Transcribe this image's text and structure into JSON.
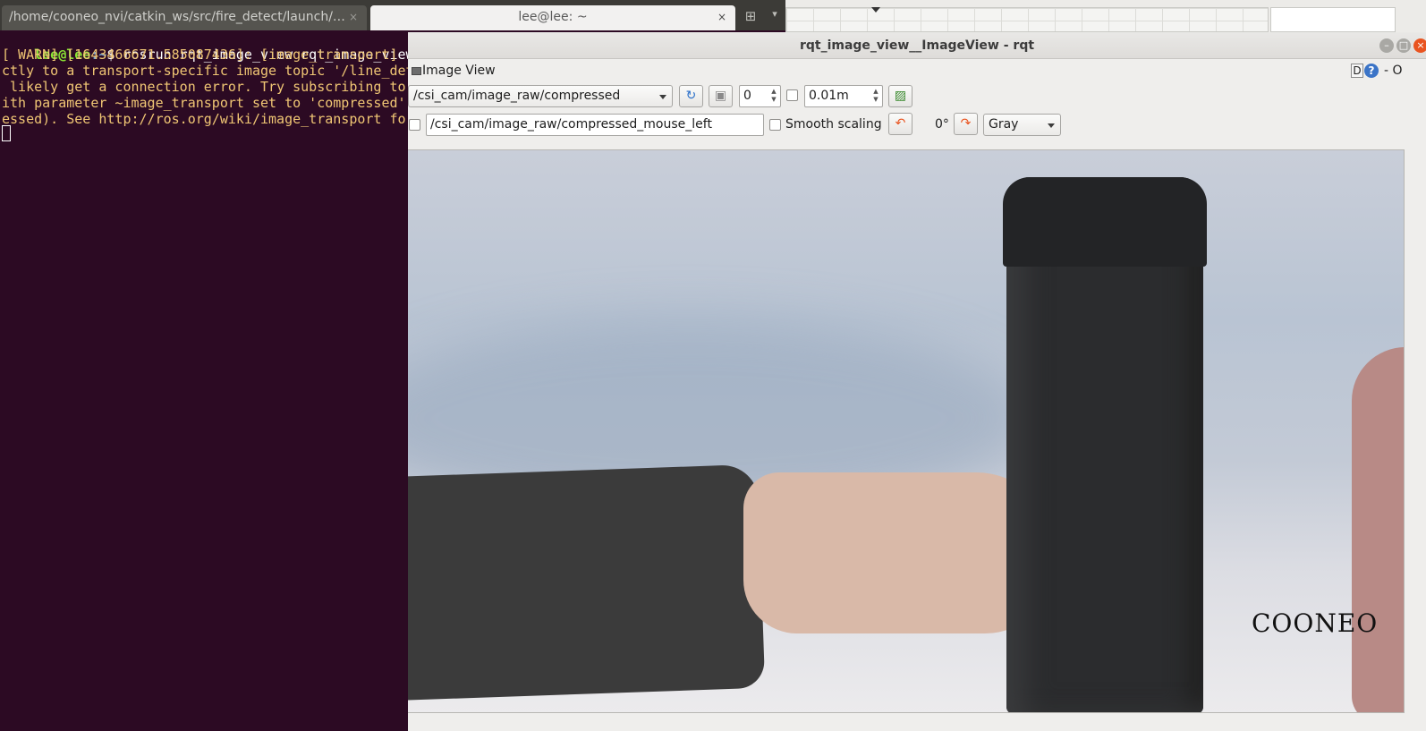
{
  "terminal": {
    "tabs": [
      {
        "label": "/home/cooneo_nvi/catkin_ws/src/fire_detect/launch/…",
        "close": "×"
      },
      {
        "label": "lee@lee: ~",
        "close": "×"
      }
    ],
    "new_tab_icon": "⊞",
    "menu_icon": "▾",
    "prompt_user": "lee@lee",
    "prompt_path": ":~",
    "prompt_symbol": "$ ",
    "command": "rosrun rqt_image_view rqt_image_view",
    "warn_lines": [
      "[ WARN] [1643466671.585087436]: [image_transport] ",
      "ctly to a transport-specific image topic '/line_det",
      " likely get a connection error. Try subscribing to",
      "ith parameter ~image_transport set to 'compressed'",
      "essed). See http://ros.org/wiki/image_transport for"
    ],
    "text_color": "#f0c674",
    "background": "#2c0a23"
  },
  "rqt": {
    "window_title": "rqt_image_view__ImageView - rqt",
    "plugin_title": "Image View",
    "d_label": "D",
    "help_label": "?",
    "extra_label": "- O",
    "topic_combo": "/csi_cam/image_raw/compressed",
    "refresh_icon": "refresh-icon",
    "zoom_value": "0",
    "duration_value": "0.01m",
    "mouse_topic_input": "/csi_cam/image_raw/compressed_mouse_left",
    "smooth_scaling_label": "Smooth scaling",
    "rotation_label": "0°",
    "color_scheme_combo": "Gray",
    "image_watermark": "COONEO",
    "accent_orange": "#e95420"
  }
}
